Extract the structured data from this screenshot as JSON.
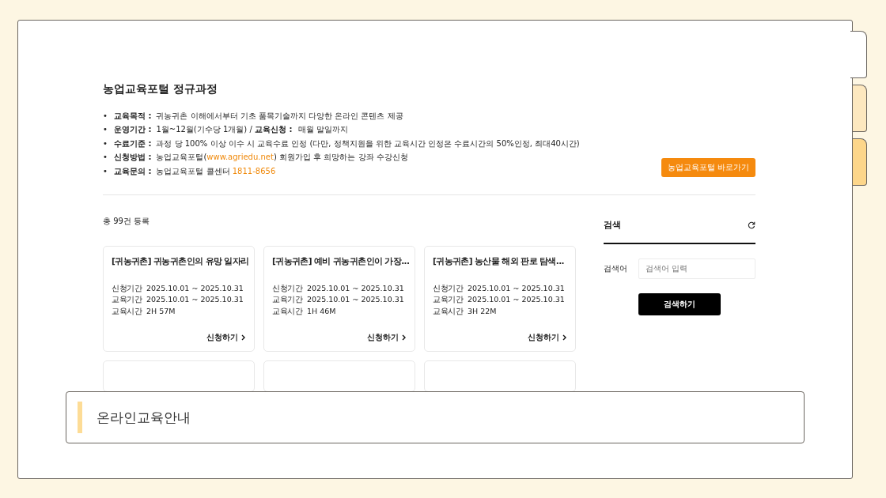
{
  "tabs": [
    {
      "selected": true,
      "color": "#ffffff"
    },
    {
      "selected": false,
      "color": "#fde8bf"
    },
    {
      "selected": false,
      "color": "#fdd68a"
    }
  ],
  "title": "농업교육포털 정규과정",
  "info": [
    {
      "bullet": "•",
      "label": "교육목적 :",
      "parts": [
        {
          "kind": "plain",
          "text": "귀농귀촌 이해에서부터 기초 품목기술까지 다양한 온라인 콘텐츠 제공"
        }
      ]
    },
    {
      "bullet": "•",
      "label": "운영기간 :",
      "parts": [
        {
          "kind": "plain",
          "text": "1월~12월(기수당 1개월) / "
        },
        {
          "kind": "bold",
          "text": "교육신청 :"
        },
        {
          "kind": "plain",
          "text": "  매월 말일까지"
        }
      ]
    },
    {
      "bullet": "•",
      "label": "수료기준 :",
      "parts": [
        {
          "kind": "plain",
          "text": "과정 당 100% 이상 이수 시 교육수료 인정 (다만, 정책지원을 위한 교육시간 인정은 수료시간의 50%인정, 최대40시간)"
        }
      ]
    },
    {
      "bullet": "•",
      "label": "신청방법 :",
      "parts": [
        {
          "kind": "plain",
          "text": "농업교육포털("
        },
        {
          "kind": "link",
          "text": "www.agriedu.net"
        },
        {
          "kind": "plain",
          "text": ") 회원가입 후 희망하는 강좌 수강신청"
        }
      ]
    },
    {
      "bullet": "•",
      "label": "교육문의 :",
      "parts": [
        {
          "kind": "plain",
          "text": "농업교육포털 콜센터 "
        },
        {
          "kind": "link",
          "text": "1811-8656"
        }
      ]
    }
  ],
  "portal_button": "농업교육포털 바로가기",
  "total": "총 99건 등록",
  "courses": [
    {
      "title": "[귀농귀촌] 귀농귀촌인의 유망 일자리",
      "rows": [
        {
          "label": "신청기간",
          "value": "2025.10.01 ~ 2025.10.31"
        },
        {
          "label": "교육기간",
          "value": "2025.10.01 ~ 2025.10.31"
        },
        {
          "label": "교육시간",
          "value": "2H 57M"
        }
      ],
      "apply": "신청하기"
    },
    {
      "title": "[귀농귀촌] 예비 귀농귀촌인이 가장...",
      "rows": [
        {
          "label": "신청기간",
          "value": "2025.10.01 ~ 2025.10.31"
        },
        {
          "label": "교육기간",
          "value": "2025.10.01 ~ 2025.10.31"
        },
        {
          "label": "교육시간",
          "value": "1H 46M"
        }
      ],
      "apply": "신청하기"
    },
    {
      "title": "[귀농귀촌] 농산물 해외 판로 탐색...",
      "rows": [
        {
          "label": "신청기간",
          "value": "2025.10.01 ~ 2025.10.31"
        },
        {
          "label": "교육기간",
          "value": "2025.10.01 ~ 2025.10.31"
        },
        {
          "label": "교육시간",
          "value": "3H 22M"
        }
      ],
      "apply": "신청하기"
    }
  ],
  "search": {
    "title": "검색",
    "label": "검색어",
    "placeholder": "검색어 입력",
    "button": "검색하기"
  },
  "banner": {
    "title": "온라인교육안내"
  }
}
